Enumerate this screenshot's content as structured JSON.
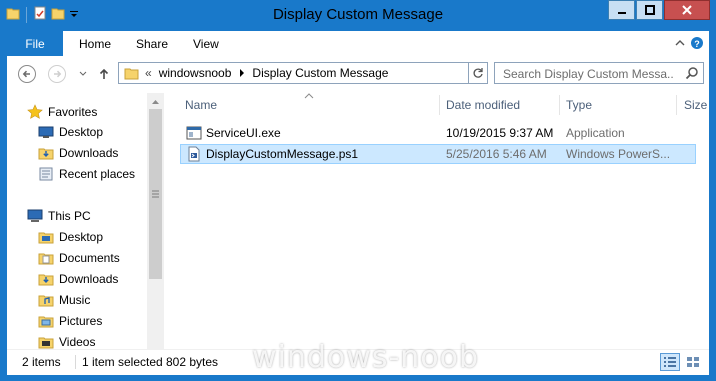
{
  "window": {
    "title": "Display Custom Message"
  },
  "ribbon": {
    "file": "File",
    "home": "Home",
    "share": "Share",
    "view": "View"
  },
  "address": {
    "root_chevron": "«",
    "parts": [
      "windowsnoob",
      "Display Custom Message"
    ]
  },
  "search": {
    "placeholder": "Search Display Custom Messa..."
  },
  "nav_pane": {
    "favorites": {
      "label": "Favorites",
      "items": [
        "Desktop",
        "Downloads",
        "Recent places"
      ]
    },
    "this_pc": {
      "label": "This PC",
      "items": [
        "Desktop",
        "Documents",
        "Downloads",
        "Music",
        "Pictures",
        "Videos"
      ]
    }
  },
  "columns": {
    "name": "Name",
    "date": "Date modified",
    "type": "Type",
    "size": "Size"
  },
  "files": [
    {
      "name": "ServiceUI.exe",
      "date": "10/19/2015 9:37 AM",
      "type": "Application",
      "selected": false
    },
    {
      "name": "DisplayCustomMessage.ps1",
      "date": "5/25/2016 5:46 AM",
      "type": "Windows PowerS...",
      "selected": true
    }
  ],
  "status": {
    "items": "2 items",
    "selected": "1 item selected",
    "size": "802 bytes"
  },
  "watermark": "windows-noob",
  "colors": {
    "accent": "#1979ca",
    "selection": "#cce8ff",
    "close": "#c75050"
  }
}
